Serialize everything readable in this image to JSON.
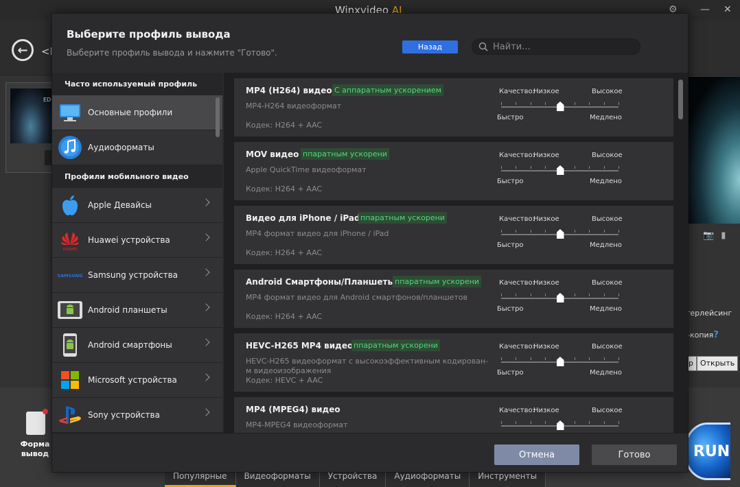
{
  "app": {
    "title": "Winxvideo",
    "title_ai": "AI",
    "back_text": "<H",
    "format_label_line1": "Форма",
    "format_label_line2": "вывод",
    "deinterlace_text": "терлейсинг",
    "copy_text": "-копия",
    "copy_help": "?",
    "btn_partial": "р",
    "btn_open": "Открыть",
    "run_label": "RUN",
    "thumb_caption": "EDE",
    "bottom_tabs": [
      "Популярные",
      "Видеоформаты",
      "Устройства",
      "Аудиоформаты",
      "Инструменты"
    ]
  },
  "modal": {
    "title": "Выберите профиль вывода",
    "subtitle": "Выберите профиль вывода и нажмите \"Готово\".",
    "back_button": "Назад",
    "search_placeholder": "Найти...",
    "cancel_button": "Отмена",
    "done_button": "Готово"
  },
  "left_panel": {
    "section1": "Часто используемый профиль",
    "section2": "Профили мобильного видео",
    "items_top": [
      {
        "label": "Основные профили",
        "icon": "monitor-icon"
      },
      {
        "label": "Аудиоформаты",
        "icon": "music-note-icon"
      }
    ],
    "items_mobile": [
      {
        "label": "Apple Девайсы",
        "icon": "apple-icon"
      },
      {
        "label": "Huawei устройства",
        "icon": "huawei-icon"
      },
      {
        "label": "Samsung устройства",
        "icon": "samsung-icon"
      },
      {
        "label": "Android планшеты",
        "icon": "android-tablet-icon"
      },
      {
        "label": "Android смартфоны",
        "icon": "android-phone-icon"
      },
      {
        "label": "Microsoft устройства",
        "icon": "microsoft-icon"
      },
      {
        "label": "Sony устройства",
        "icon": "playstation-icon"
      }
    ],
    "huawei_text": "HUAWEI",
    "samsung_text": "SAMSUNG"
  },
  "quality": {
    "label": "Качество:",
    "low": "Низкое",
    "high": "Высокое",
    "fast": "Быстро",
    "slow": "Медлено",
    "level": 0.5
  },
  "profiles": [
    {
      "title": "MP4 (H264) видео",
      "tag": "С аппаратным ускорением",
      "desc": "MP4-H264 видеоформат",
      "codec": "Кодек: H264 + AAC"
    },
    {
      "title": "MOV видео",
      "tag": "ппаратным ускорени",
      "desc": "Apple QuickTime видеоформат",
      "codec": "Кодек: H264 + AAC"
    },
    {
      "title": "Видео для iPhone / iPad",
      "tag": "ппаратным ускорени",
      "desc": "MP4 формат видео для iPhone / iPad",
      "codec": "Кодек: H264 + AAC"
    },
    {
      "title": "Android Смартфоны/Планшеты",
      "tag": "ппаратным ускорени",
      "desc": "MP4 формат видео для Android смартфонов/планшетов",
      "codec": "Кодек: H264 + AAC"
    },
    {
      "title": "HEVC-H265 MP4 видео",
      "tag": "ппаратным ускорени",
      "desc": "HEVC-H265 видеоформат с высокоэффективным кодирован-м видеоизображения",
      "codec": "Кодек: HEVC + AAC"
    },
    {
      "title": "MP4 (MPEG4) видео",
      "tag": "",
      "desc": "MP4-MPEG4 видеоформат",
      "codec": ""
    }
  ],
  "colors": {
    "accent_blue": "#2f6fe0",
    "tag_green": "#4ddc79",
    "title_ai": "#f0a020"
  }
}
